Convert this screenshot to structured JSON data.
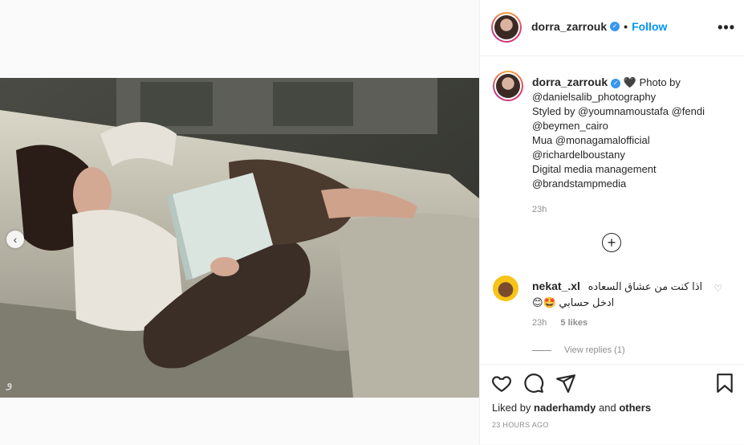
{
  "post": {
    "username": "dorra_zarrouk",
    "follow_label": "Follow",
    "more_icon": "more-options-icon",
    "watermark": "و"
  },
  "caption": {
    "username": "dorra_zarrouk",
    "lines": [
      "🖤 Photo by",
      "@danielsalib_photography",
      "Styled by @youmnamoustafa @fendi",
      "@beymen_cairo",
      "Mua @monagamalofficial",
      "@richardelboustany",
      "Digital media management",
      "@brandstampmedia"
    ],
    "time": "23h"
  },
  "comment": {
    "username": "nekat_.xl",
    "line1": "اذا كنت من عشاق السعاده",
    "line2": "ادخل حسابي 🤩😊",
    "time": "23h",
    "likes": "5 likes",
    "view_replies": "View replies (1)"
  },
  "footer": {
    "liked_prefix": "Liked by",
    "liked_user": "naderhamdy",
    "liked_and": "and",
    "liked_others": "others",
    "timestamp": "23 HOURS AGO"
  },
  "colors": {
    "accent": "#0095f6",
    "verified": "#3897f0",
    "muted": "#8e8e8e"
  }
}
